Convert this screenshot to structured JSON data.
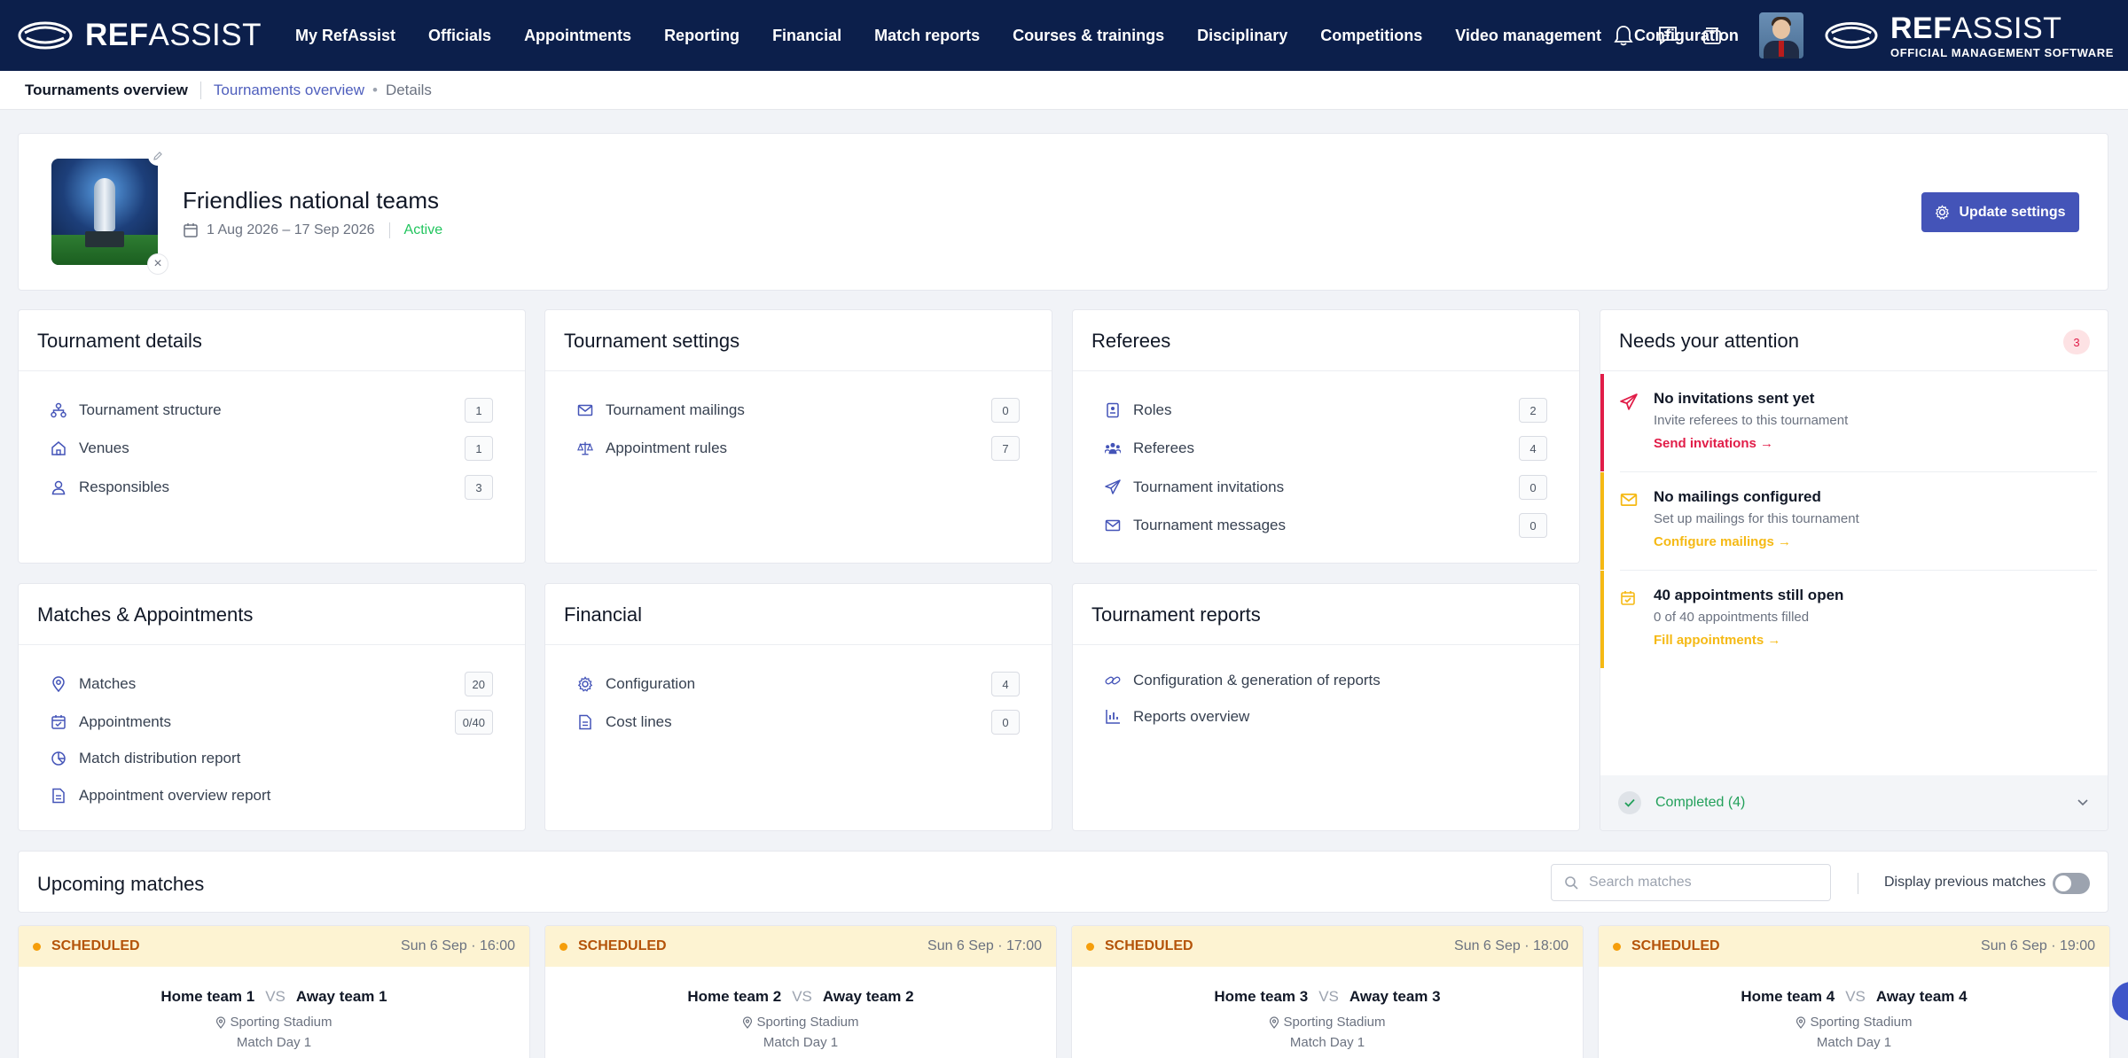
{
  "brand": {
    "name_bold": "REF",
    "name_light": "ASSIST"
  },
  "brand_right": {
    "name_bold": "REF",
    "name_light": "ASSIST",
    "tagline": "OFFICIAL MANAGEMENT SOFTWARE"
  },
  "nav": [
    "My RefAssist",
    "Officials",
    "Appointments",
    "Reporting",
    "Financial",
    "Match reports",
    "Courses & trainings",
    "Disciplinary",
    "Competitions",
    "Video management",
    "Configuration"
  ],
  "nav_icons": [
    "bell-icon",
    "chat-icon",
    "cards-icon"
  ],
  "breadcrumb": {
    "title": "Tournaments overview",
    "link": "Tournaments overview",
    "sep": "•",
    "current": "Details"
  },
  "tournament": {
    "name": "Friendlies national teams",
    "dates": "1 Aug 2026 – 17 Sep 2026",
    "status": "Active",
    "update_button": "Update settings"
  },
  "details": {
    "title": "Tournament details",
    "items": [
      {
        "label": "Tournament structure",
        "count": "1",
        "icon": "structure-icon"
      },
      {
        "label": "Venues",
        "count": "1",
        "icon": "home-icon"
      },
      {
        "label": "Responsibles",
        "count": "3",
        "icon": "user-icon"
      }
    ]
  },
  "settings": {
    "title": "Tournament settings",
    "items": [
      {
        "label": "Tournament mailings",
        "count": "0",
        "icon": "mail-icon"
      },
      {
        "label": "Appointment rules",
        "count": "7",
        "icon": "scale-icon"
      }
    ]
  },
  "referees": {
    "title": "Referees",
    "items": [
      {
        "label": "Roles",
        "count": "2",
        "icon": "badge-icon"
      },
      {
        "label": "Referees",
        "count": "4",
        "icon": "users-icon"
      },
      {
        "label": "Tournament invitations",
        "count": "0",
        "icon": "send-icon"
      },
      {
        "label": "Tournament messages",
        "count": "0",
        "icon": "mail-icon"
      }
    ]
  },
  "matches": {
    "title": "Matches & Appointments",
    "items": [
      {
        "label": "Matches",
        "count": "20",
        "icon": "pin-icon"
      },
      {
        "label": "Appointments",
        "count": "0/40",
        "icon": "calendar-check-icon"
      },
      {
        "label": "Match distribution report",
        "count": "",
        "icon": "pie-icon"
      },
      {
        "label": "Appointment overview report",
        "count": "",
        "icon": "document-icon"
      }
    ]
  },
  "financial": {
    "title": "Financial",
    "items": [
      {
        "label": "Configuration",
        "count": "4",
        "icon": "gear-icon"
      },
      {
        "label": "Cost lines",
        "count": "0",
        "icon": "document-icon"
      }
    ]
  },
  "reports": {
    "title": "Tournament reports",
    "items": [
      {
        "label": "Configuration & generation of reports",
        "icon": "link-icon"
      },
      {
        "label": "Reports overview",
        "icon": "bar-chart-icon"
      }
    ]
  },
  "attention": {
    "title": "Needs your attention",
    "count": "3",
    "items": [
      {
        "title": "No invitations sent yet",
        "sub": "Invite referees to this tournament",
        "link": "Send invitations →",
        "color": "#e11d48",
        "icon": "send-icon"
      },
      {
        "title": "No mailings configured",
        "sub": "Set up mailings for this tournament",
        "link": "Configure mailings →",
        "color": "#f5b914",
        "icon": "mail-icon"
      },
      {
        "title": "40 appointments still open",
        "sub": "0 of 40 appointments filled",
        "link": "Fill appointments →",
        "color": "#f5b914",
        "icon": "calendar-check-icon"
      }
    ],
    "completed": "Completed (4)"
  },
  "upcoming": {
    "title": "Upcoming matches",
    "search_placeholder": "Search matches",
    "toggle_label": "Display previous matches",
    "vs": "VS",
    "matches": [
      {
        "status": "SCHEDULED",
        "time": "Sun 6 Sep · 16:00",
        "home": "Home team 1",
        "away": "Away team 1",
        "venue": "Sporting Stadium",
        "day": "Match Day 1"
      },
      {
        "status": "SCHEDULED",
        "time": "Sun 6 Sep · 17:00",
        "home": "Home team 2",
        "away": "Away team 2",
        "venue": "Sporting Stadium",
        "day": "Match Day 1"
      },
      {
        "status": "SCHEDULED",
        "time": "Sun 6 Sep · 18:00",
        "home": "Home team 3",
        "away": "Away team 3",
        "venue": "Sporting Stadium",
        "day": "Match Day 1"
      },
      {
        "status": "SCHEDULED",
        "time": "Sun 6 Sep · 19:00",
        "home": "Home team 4",
        "away": "Away team 4",
        "venue": "Sporting Stadium",
        "day": "Match Day 1"
      }
    ]
  },
  "colors": {
    "nav_bg": "#0c1f4b",
    "accent": "#4454b8",
    "active": "#22c55e",
    "scheduled": "#b45309"
  }
}
